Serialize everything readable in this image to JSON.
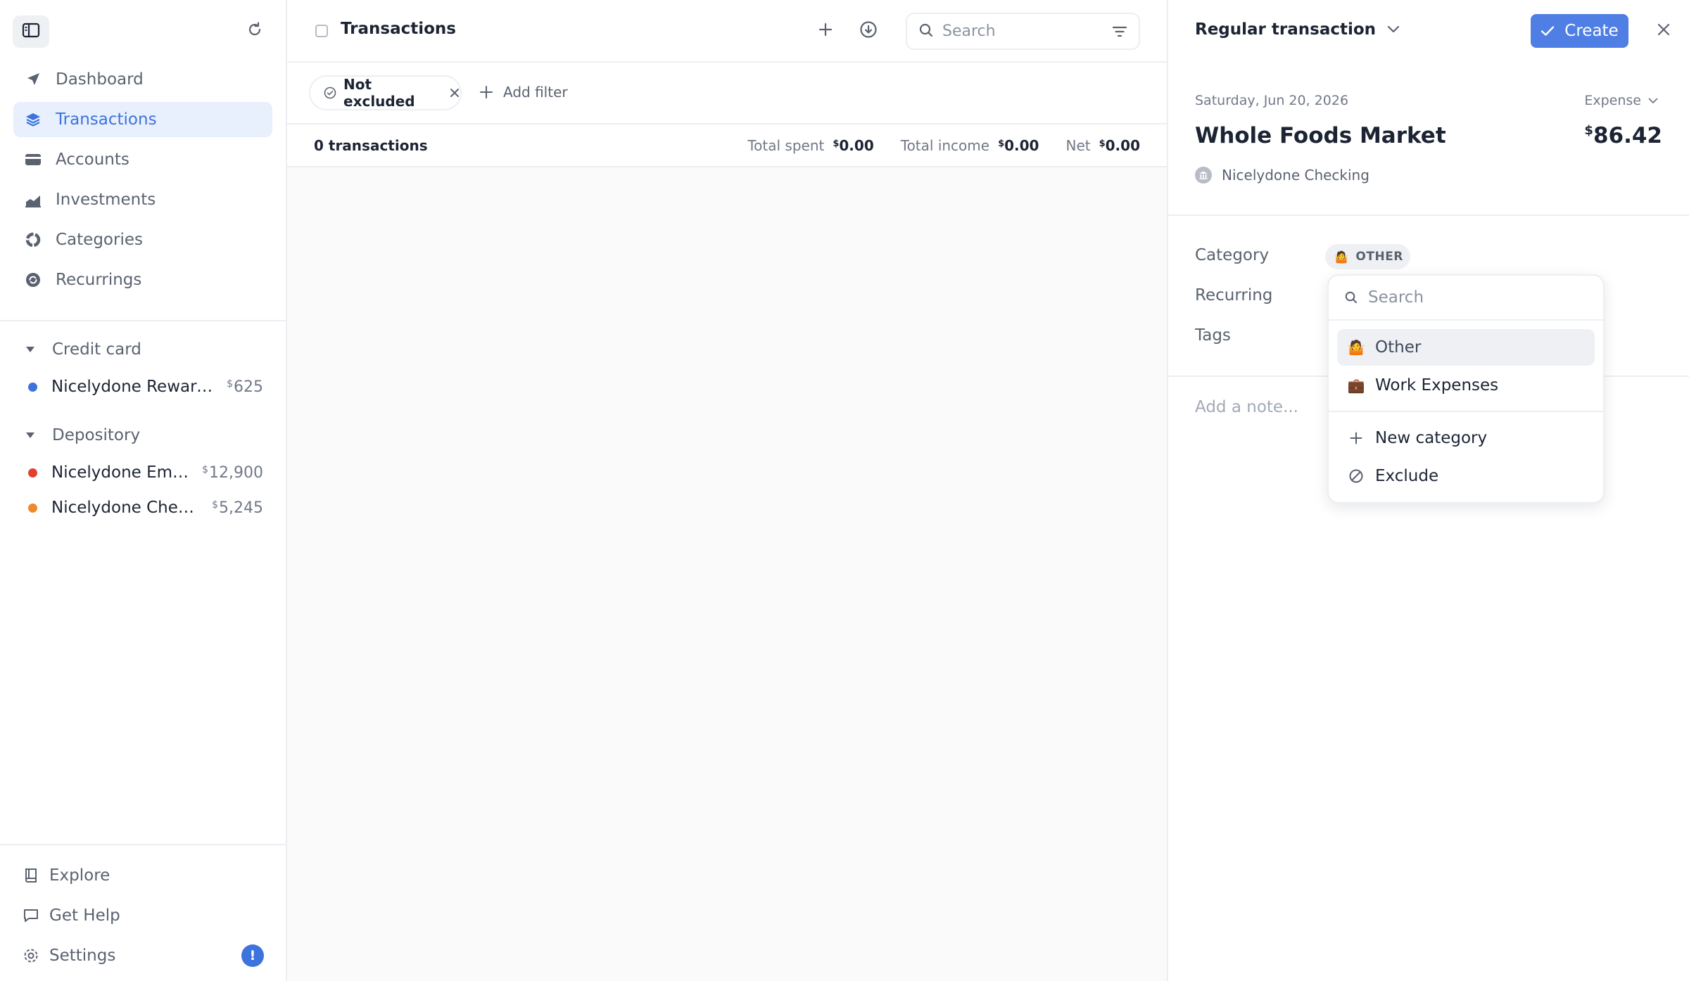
{
  "sidebar": {
    "nav": [
      {
        "label": "Dashboard",
        "icon": "navigation-arrow-icon",
        "active": false
      },
      {
        "label": "Transactions",
        "icon": "layers-icon",
        "active": true
      },
      {
        "label": "Accounts",
        "icon": "credit-card-icon",
        "active": false
      },
      {
        "label": "Investments",
        "icon": "chart-area-icon",
        "active": false
      },
      {
        "label": "Categories",
        "icon": "donut-icon",
        "active": false
      },
      {
        "label": "Recurrings",
        "icon": "recurring-icon",
        "active": false
      }
    ],
    "groups": [
      {
        "label": "Credit card",
        "accounts": [
          {
            "name": "Nicelydone Reward...",
            "currency": "$",
            "balance": "625",
            "color": "#3d73dd"
          }
        ]
      },
      {
        "label": "Depository",
        "accounts": [
          {
            "name": "Nicelydone Emer...",
            "currency": "$",
            "balance": "12,900",
            "color": "#e2402f"
          },
          {
            "name": "Nicelydone Check...",
            "currency": "$",
            "balance": "5,245",
            "color": "#ef8a2b"
          }
        ]
      }
    ],
    "bottom": [
      {
        "label": "Explore",
        "icon": "book-icon"
      },
      {
        "label": "Get Help",
        "icon": "chat-bubble-icon"
      },
      {
        "label": "Settings",
        "icon": "gear-icon",
        "badge": "!"
      }
    ]
  },
  "main": {
    "title": "Transactions",
    "search_placeholder": "Search",
    "filter_chip": "Not excluded",
    "add_filter": "Add filter",
    "summary": {
      "count": "0 transactions",
      "total_spent_label": "Total spent",
      "total_spent_currency": "$",
      "total_spent": "0.00",
      "total_income_label": "Total income",
      "total_income_currency": "$",
      "total_income": "0.00",
      "net_label": "Net",
      "net_currency": "$",
      "net": "0.00"
    }
  },
  "panel": {
    "type": "Regular transaction",
    "create_label": "Create",
    "date": "Saturday, Jun 20, 2026",
    "kind": "Expense",
    "merchant": "Whole Foods Market",
    "amount_currency": "$",
    "amount": "86.42",
    "account": "Nicelydone Checking",
    "fields": {
      "category_label": "Category",
      "category_value": "OTHER",
      "category_emoji": "🤷",
      "recurring_label": "Recurring",
      "tags_label": "Tags"
    },
    "note_placeholder": "Add a note..."
  },
  "dropdown": {
    "search_placeholder": "Search",
    "items": [
      {
        "label": "Other",
        "emoji": "🤷",
        "highlighted": true
      },
      {
        "label": "Work Expenses",
        "emoji": "💼",
        "highlighted": false
      }
    ],
    "actions": [
      {
        "label": "New category",
        "icon": "plus-icon"
      },
      {
        "label": "Exclude",
        "icon": "prohibit-icon"
      }
    ]
  },
  "colors": {
    "accent": "#3d73dd",
    "create_button": "#4f7fe4"
  }
}
